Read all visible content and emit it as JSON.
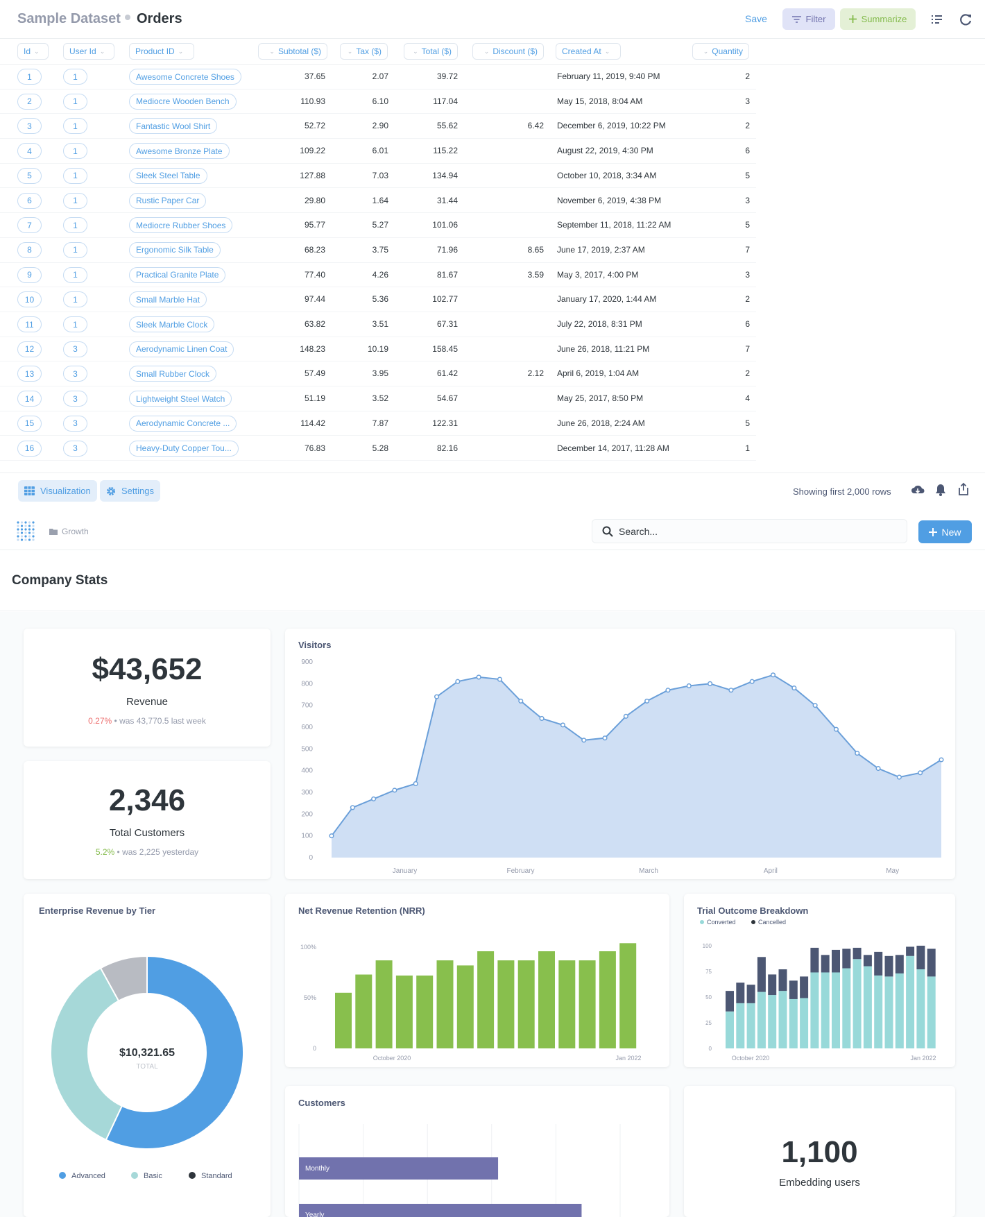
{
  "query_header": {
    "dataset": "Sample Dataset",
    "title": "Orders",
    "save": "Save",
    "filter": "Filter",
    "summarize": "Summarize"
  },
  "columns": [
    "Id",
    "User Id",
    "Product ID",
    "Subtotal ($)",
    "Tax ($)",
    "Total ($)",
    "Discount ($)",
    "Created At",
    "Quantity"
  ],
  "rows": [
    {
      "id": "1",
      "user": "1",
      "product": "Awesome Concrete Shoes",
      "subtotal": "37.65",
      "tax": "2.07",
      "total": "39.72",
      "discount": "",
      "created": "February 11, 2019, 9:40 PM",
      "qty": "2"
    },
    {
      "id": "2",
      "user": "1",
      "product": "Mediocre Wooden Bench",
      "subtotal": "110.93",
      "tax": "6.10",
      "total": "117.04",
      "discount": "",
      "created": "May 15, 2018, 8:04 AM",
      "qty": "3"
    },
    {
      "id": "3",
      "user": "1",
      "product": "Fantastic Wool Shirt",
      "subtotal": "52.72",
      "tax": "2.90",
      "total": "55.62",
      "discount": "6.42",
      "created": "December 6, 2019, 10:22 PM",
      "qty": "2"
    },
    {
      "id": "4",
      "user": "1",
      "product": "Awesome Bronze Plate",
      "subtotal": "109.22",
      "tax": "6.01",
      "total": "115.22",
      "discount": "",
      "created": "August 22, 2019, 4:30 PM",
      "qty": "6"
    },
    {
      "id": "5",
      "user": "1",
      "product": "Sleek Steel Table",
      "subtotal": "127.88",
      "tax": "7.03",
      "total": "134.94",
      "discount": "",
      "created": "October 10, 2018, 3:34 AM",
      "qty": "5"
    },
    {
      "id": "6",
      "user": "1",
      "product": "Rustic Paper Car",
      "subtotal": "29.80",
      "tax": "1.64",
      "total": "31.44",
      "discount": "",
      "created": "November 6, 2019, 4:38 PM",
      "qty": "3"
    },
    {
      "id": "7",
      "user": "1",
      "product": "Mediocre Rubber Shoes",
      "subtotal": "95.77",
      "tax": "5.27",
      "total": "101.06",
      "discount": "",
      "created": "September 11, 2018, 11:22 AM",
      "qty": "5"
    },
    {
      "id": "8",
      "user": "1",
      "product": "Ergonomic Silk Table",
      "subtotal": "68.23",
      "tax": "3.75",
      "total": "71.96",
      "discount": "8.65",
      "created": "June 17, 2019, 2:37 AM",
      "qty": "7"
    },
    {
      "id": "9",
      "user": "1",
      "product": "Practical Granite Plate",
      "subtotal": "77.40",
      "tax": "4.26",
      "total": "81.67",
      "discount": "3.59",
      "created": "May 3, 2017, 4:00 PM",
      "qty": "3"
    },
    {
      "id": "10",
      "user": "1",
      "product": "Small Marble Hat",
      "subtotal": "97.44",
      "tax": "5.36",
      "total": "102.77",
      "discount": "",
      "created": "January 17, 2020, 1:44 AM",
      "qty": "2"
    },
    {
      "id": "11",
      "user": "1",
      "product": "Sleek Marble Clock",
      "subtotal": "63.82",
      "tax": "3.51",
      "total": "67.31",
      "discount": "",
      "created": "July 22, 2018, 8:31 PM",
      "qty": "6"
    },
    {
      "id": "12",
      "user": "3",
      "product": "Aerodynamic Linen Coat",
      "subtotal": "148.23",
      "tax": "10.19",
      "total": "158.45",
      "discount": "",
      "created": "June 26, 2018, 11:21 PM",
      "qty": "7"
    },
    {
      "id": "13",
      "user": "3",
      "product": "Small Rubber Clock",
      "subtotal": "57.49",
      "tax": "3.95",
      "total": "61.42",
      "discount": "2.12",
      "created": "April 6, 2019, 1:04 AM",
      "qty": "2"
    },
    {
      "id": "14",
      "user": "3",
      "product": "Lightweight Steel Watch",
      "subtotal": "51.19",
      "tax": "3.52",
      "total": "54.67",
      "discount": "",
      "created": "May 25, 2017, 8:50 PM",
      "qty": "4"
    },
    {
      "id": "15",
      "user": "3",
      "product": "Aerodynamic Concrete ...",
      "subtotal": "114.42",
      "tax": "7.87",
      "total": "122.31",
      "discount": "",
      "created": "June 26, 2018, 2:24 AM",
      "qty": "5"
    },
    {
      "id": "16",
      "user": "3",
      "product": "Heavy-Duty Copper Tou...",
      "subtotal": "76.83",
      "tax": "5.28",
      "total": "82.16",
      "discount": "",
      "created": "December 14, 2017, 11:28 AM",
      "qty": "1"
    }
  ],
  "bottom_bar": {
    "visualization": "Visualization",
    "settings": "Settings",
    "rows_count": "Showing first 2,000 rows"
  },
  "dash_nav": {
    "collection": "Growth",
    "search_placeholder": "Search...",
    "new": "New"
  },
  "dashboard": {
    "title": "Company Stats",
    "revenue": {
      "value": "$43,652",
      "label": "Revenue",
      "change": "0.27%",
      "compare": "was 43,770.5 last week",
      "change_color": "#ed6e6e"
    },
    "customers": {
      "value": "2,346",
      "label": "Total Customers",
      "change": "5.2%",
      "compare": "was 2,225 yesterday",
      "change_color": "#84bb4c"
    },
    "embedding": {
      "value": "1,100",
      "label": "Embedding users"
    },
    "visitors_title": "Visitors",
    "tier_title": "Enterprise Revenue by Tier",
    "tier_total_value": "$10,321.65",
    "tier_total_label": "TOTAL",
    "nrr_title": "Net Revenue Retention (NRR)",
    "trial_title": "Trial Outcome Breakdown",
    "customers_title": "Customers"
  },
  "colors": {
    "brand": "#509ee3",
    "filter": "#7172ad",
    "summarize": "#84bb4c",
    "nrr_bar": "#88bf4d",
    "converted": "#98d9d9",
    "cancelled": "#4c5773",
    "customers_bar": "#7172ad"
  },
  "chart_data": [
    {
      "type": "area",
      "title": "Visitors",
      "x_ticks": [
        "January",
        "February",
        "March",
        "April",
        "May"
      ],
      "ylim": [
        0,
        900
      ],
      "y_ticks": [
        0,
        100,
        200,
        300,
        400,
        500,
        600,
        700,
        800,
        900
      ],
      "series": [
        {
          "values": [
            100,
            230,
            270,
            310,
            340,
            740,
            810,
            830,
            820,
            720,
            640,
            610,
            540,
            550,
            650,
            720,
            770,
            790,
            800,
            770,
            810,
            840,
            780,
            700,
            590,
            480,
            410,
            370,
            390,
            450
          ]
        }
      ]
    },
    {
      "type": "pie",
      "title": "Enterprise Revenue by Tier",
      "categories": [
        "Advanced",
        "Basic",
        "Standard"
      ],
      "values": [
        57,
        35,
        8
      ],
      "colors": [
        "#509ee3",
        "#a6d8d8",
        "#b8bbc2"
      ]
    },
    {
      "type": "bar",
      "title": "Net Revenue Retention (NRR)",
      "x_ticks": [
        "October 2020",
        "Jan 2022"
      ],
      "y_ticks": [
        "0",
        "50%",
        "100%"
      ],
      "ylim": [
        0,
        1.2
      ],
      "values": [
        0.55,
        0.73,
        0.87,
        0.72,
        0.72,
        0.87,
        0.82,
        0.96,
        0.87,
        0.87,
        0.96,
        0.87,
        0.87,
        0.96,
        1.04
      ]
    },
    {
      "type": "bar",
      "title": "Trial Outcome Breakdown",
      "stacked": true,
      "x_ticks": [
        "October 2020",
        "Jan 2022"
      ],
      "ylim": [
        0,
        100
      ],
      "y_ticks": [
        0,
        25,
        50,
        75,
        100
      ],
      "series": [
        {
          "name": "Converted",
          "values": [
            36,
            44,
            44,
            55,
            52,
            56,
            48,
            49,
            74,
            74,
            74,
            78,
            87,
            80,
            71,
            70,
            73,
            90,
            77,
            70
          ]
        },
        {
          "name": "Cancelled",
          "values": [
            20,
            20,
            18,
            34,
            20,
            21,
            18,
            21,
            24,
            17,
            22,
            19,
            11,
            11,
            23,
            20,
            18,
            9,
            23,
            27
          ]
        }
      ]
    },
    {
      "type": "bar",
      "title": "Customers",
      "orientation": "horizontal",
      "categories": [
        "Monthly",
        "Yearly"
      ],
      "values": [
        62,
        88
      ]
    }
  ]
}
